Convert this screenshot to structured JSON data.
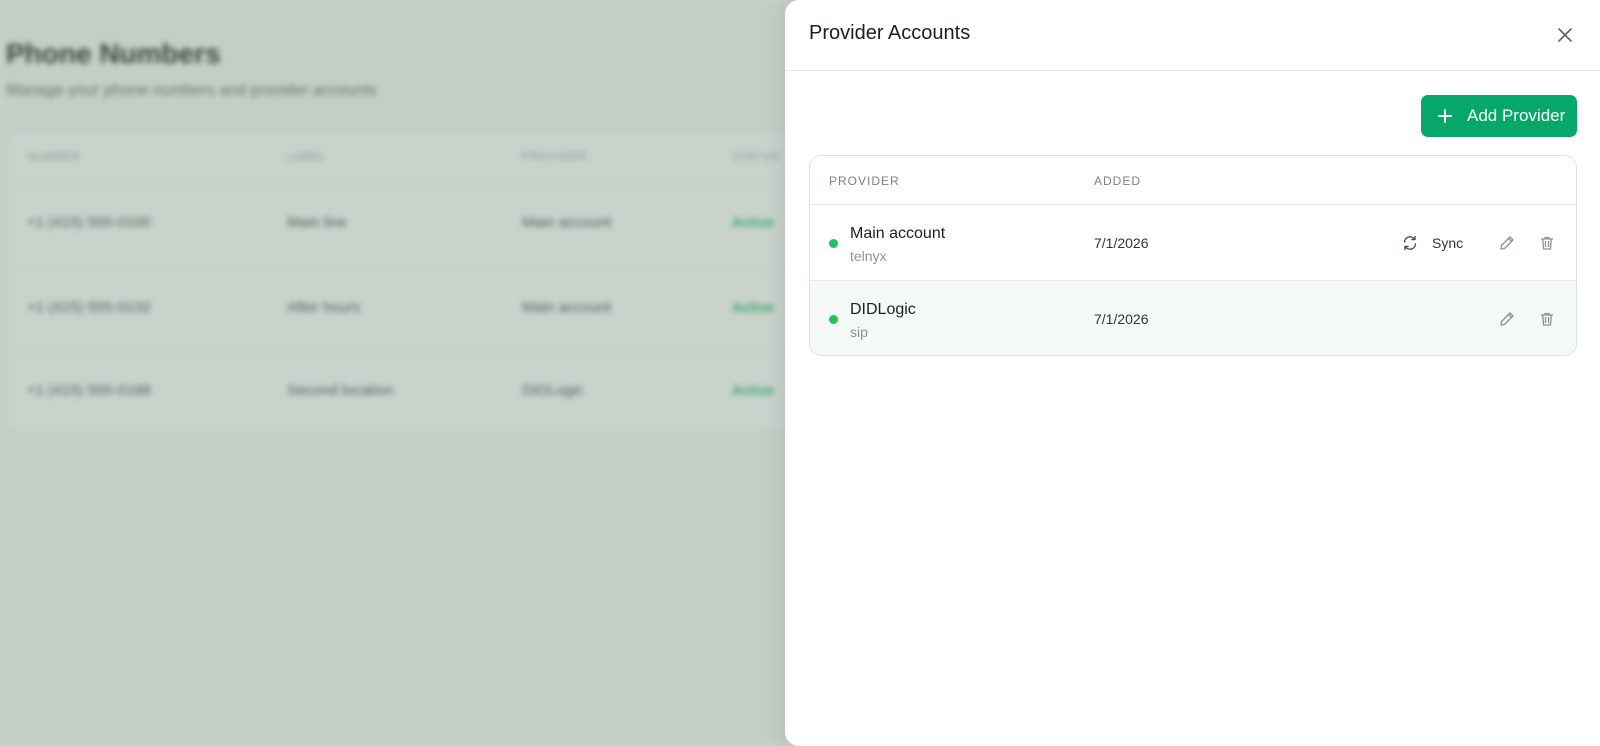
{
  "background": {
    "title": "Phone Numbers",
    "subtitle": "Manage your phone numbers and provider accounts",
    "columns": [
      "NUMBER",
      "LABEL",
      "PROVIDER",
      "STATUS"
    ],
    "rows": [
      {
        "number": "+1 (415) 555-0100",
        "label": "Main line",
        "provider": "Main account",
        "status": "Active"
      },
      {
        "number": "+1 (415) 555-0132",
        "label": "After hours",
        "provider": "Main account",
        "status": "Active"
      },
      {
        "number": "+1 (415) 555-0188",
        "label": "Second location",
        "provider": "DIDLogic",
        "status": "Active"
      }
    ]
  },
  "drawer": {
    "title": "Provider Accounts",
    "close_icon": "close-icon",
    "add_button": {
      "label": "Add Provider",
      "icon": "plus-icon",
      "color": "#06a86a"
    },
    "table": {
      "columns": {
        "provider": "PROVIDER",
        "added": "ADDED"
      },
      "rows": [
        {
          "name": "Main account",
          "type": "telnyx",
          "added": "7/1/2026",
          "status_color": "#22c161",
          "sync_label": "Sync"
        },
        {
          "name": "DIDLogic",
          "type": "sip",
          "added": "7/1/2026",
          "status_color": "#22c161"
        }
      ]
    }
  }
}
